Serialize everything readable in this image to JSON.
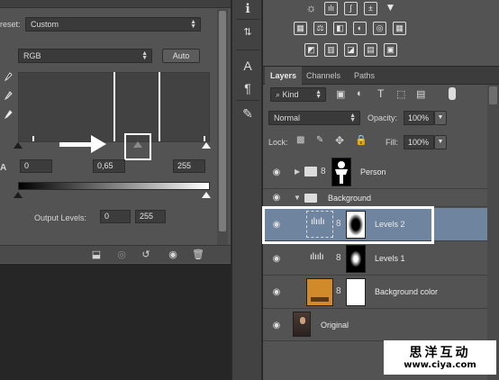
{
  "properties": {
    "preset_label": "reset:",
    "preset_value": "Custom",
    "channel_value": "RGB",
    "auto_label": "Auto",
    "input_black": "0",
    "input_gamma": "0,65",
    "input_white": "255",
    "output_label": "Output Levels:",
    "output_black": "0",
    "output_white": "255"
  },
  "layers_panel": {
    "tabs": [
      {
        "label": "Layers"
      },
      {
        "label": "Channels"
      },
      {
        "label": "Paths"
      }
    ],
    "filter_kind": "Kind",
    "blend_mode": "Normal",
    "opacity_label": "Opacity:",
    "opacity_value": "100%",
    "lock_label": "Lock:",
    "fill_label": "Fill:",
    "fill_value": "100%",
    "layers": [
      {
        "name": "Person"
      },
      {
        "name": "Background"
      },
      {
        "name": "Levels 2"
      },
      {
        "name": "Levels 1"
      },
      {
        "name": "Background color"
      },
      {
        "name": "Original"
      }
    ]
  },
  "watermark": {
    "title": "思洋互动",
    "url": "www.ciya.com"
  },
  "colors": {
    "panel_bg": "#535353",
    "selected_layer": "#6e849f",
    "bg_color_swatch": "#d08a2a"
  }
}
